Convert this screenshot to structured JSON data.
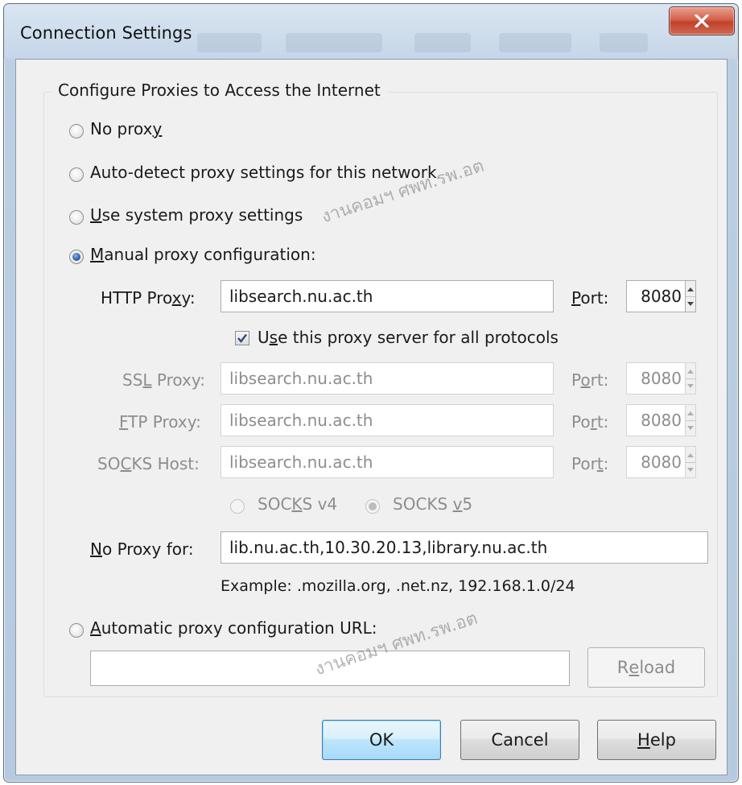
{
  "window": {
    "title": "Connection Settings",
    "close_icon": "close-x-icon",
    "accent_color": "#c3412b"
  },
  "group": {
    "legend": "Configure Proxies to Access the Internet"
  },
  "options": {
    "no_proxy": {
      "pre": "No prox",
      "key": "y",
      "post": "",
      "selected": false
    },
    "auto_detect": {
      "label": "Auto-detect proxy settings for this network",
      "selected": false
    },
    "system": {
      "pre": "",
      "key": "U",
      "post": "se system proxy settings",
      "selected": false
    },
    "manual": {
      "pre": "",
      "key": "M",
      "post": "anual proxy configuration:",
      "selected": true
    },
    "auto_url": {
      "pre": "",
      "key": "A",
      "post": "utomatic proxy configuration URL:",
      "selected": false
    }
  },
  "http": {
    "label_pre": "HTTP Pro",
    "label_key": "x",
    "label_post": "y:",
    "value": "libsearch.nu.ac.th",
    "port_pre": "",
    "port_key": "P",
    "port_post": "ort:",
    "port_value": "8080"
  },
  "use_all": {
    "pre": "U",
    "key": "s",
    "post": "e this proxy server for all protocols",
    "checked": true
  },
  "ssl": {
    "label_pre": "SS",
    "label_key": "L",
    "label_post": " Proxy:",
    "value": "libsearch.nu.ac.th",
    "port_pre": "P",
    "port_key": "o",
    "port_post": "rt:",
    "port_value": "8080"
  },
  "ftp": {
    "label_pre": "",
    "label_key": "F",
    "label_post": "TP Proxy:",
    "value": "libsearch.nu.ac.th",
    "port_pre": "Po",
    "port_key": "r",
    "port_post": "t:",
    "port_value": "8080"
  },
  "socks": {
    "label_pre": "SO",
    "label_key": "C",
    "label_post": "KS Host:",
    "value": "libsearch.nu.ac.th",
    "port_pre": "Por",
    "port_key": "t",
    "port_post": ":",
    "port_value": "8080"
  },
  "socks_version": {
    "v4_pre": "SOC",
    "v4_key": "K",
    "v4_post": "S v4",
    "v4_selected": false,
    "v5_pre": "SOCKS ",
    "v5_key": "v",
    "v5_post": "5",
    "v5_selected": true
  },
  "no_proxy_for": {
    "label_pre": "",
    "label_key": "N",
    "label_post": "o Proxy for:",
    "value": "lib.nu.ac.th,10.30.20.13,library.nu.ac.th",
    "example": "Example: .mozilla.org, .net.nz, 192.168.1.0/24"
  },
  "auto_url_field": {
    "value": ""
  },
  "reload": {
    "pre": "R",
    "key": "e",
    "post": "load"
  },
  "buttons": {
    "ok": "OK",
    "cancel": "Cancel",
    "help_pre": "",
    "help_key": "H",
    "help_post": "elp"
  },
  "watermark": {
    "text1": "งานคอมฯ ศพท.รพ.อต",
    "text2": "งานคอมฯ ศพท.รพ.อต"
  }
}
